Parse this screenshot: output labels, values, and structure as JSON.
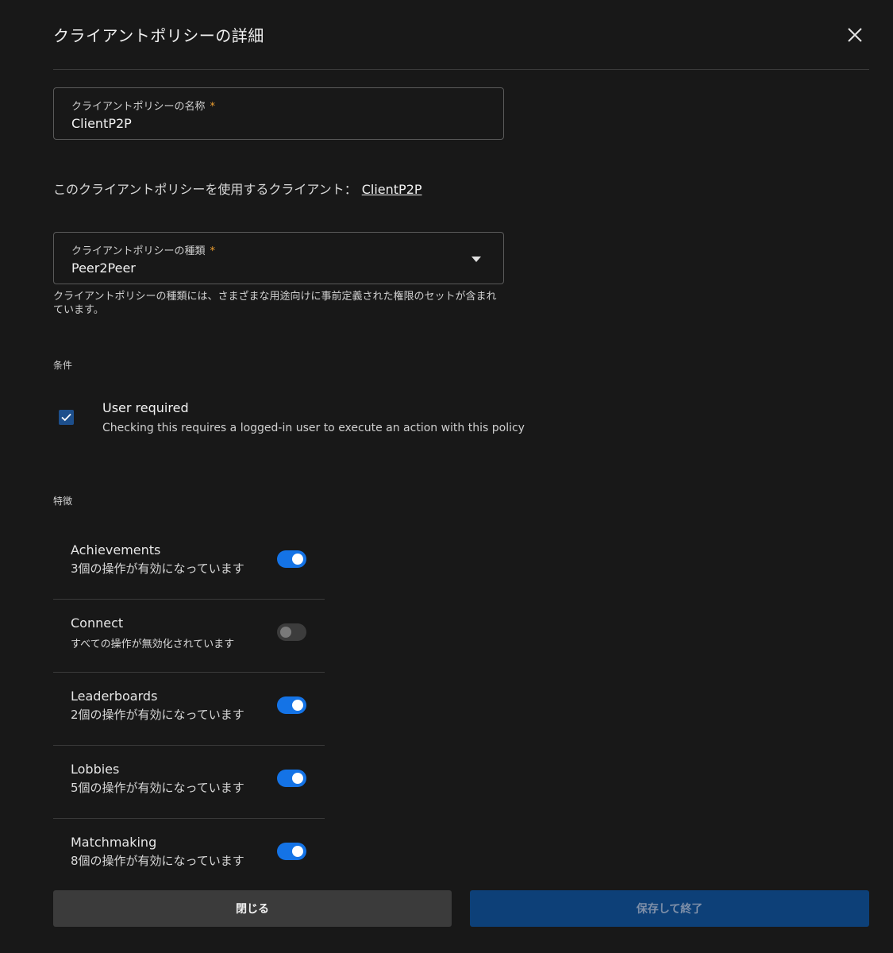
{
  "header": {
    "title": "クライアントポリシーの詳細"
  },
  "name_field": {
    "label": "クライアントポリシーの名称",
    "required_mark": "*",
    "value": "ClientP2P"
  },
  "usage": {
    "text": "このクライアントポリシーを使用するクライアント：",
    "link": "ClientP2P"
  },
  "type_field": {
    "label": "クライアントポリシーの種類",
    "required_mark": "*",
    "value": "Peer2Peer",
    "helper": "クライアントポリシーの種類には、さまざまな用途向けに事前定義された権限のセットが含まれています。"
  },
  "conditions": {
    "section_label": "条件",
    "user_required": {
      "title": "User required",
      "description": "Checking this requires a logged-in user to execute an action with this policy",
      "checked": true
    }
  },
  "features": {
    "section_label": "特徴",
    "items": [
      {
        "name": "Achievements",
        "status": "3個の操作が有効になっています",
        "enabled": true
      },
      {
        "name": "Connect",
        "status": "すべての操作が無効化されています",
        "enabled": false
      },
      {
        "name": "Leaderboards",
        "status": "2個の操作が有効になっています",
        "enabled": true
      },
      {
        "name": "Lobbies",
        "status": "5個の操作が有効になっています",
        "enabled": true
      },
      {
        "name": "Matchmaking",
        "status": "8個の操作が有効になっています",
        "enabled": true
      }
    ]
  },
  "footer": {
    "close_label": "閉じる",
    "save_label": "保存して終了"
  },
  "colors": {
    "background": "#181818",
    "toggle_on": "#1473e6",
    "save_button": "#0d4078",
    "required_mark": "#f0a030"
  }
}
